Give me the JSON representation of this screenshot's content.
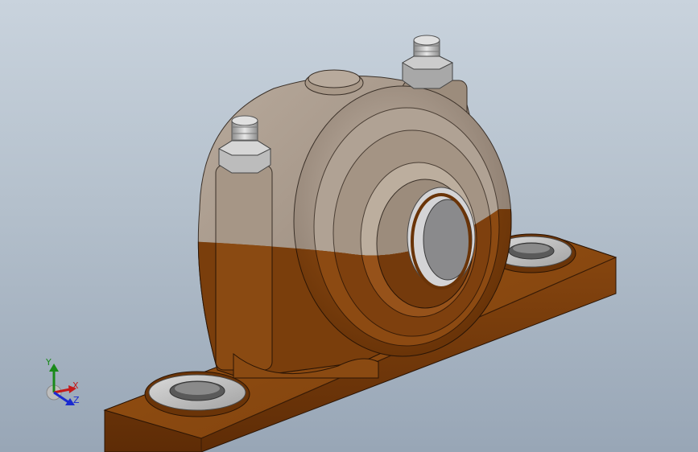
{
  "viewport": {
    "background_top": "#c9d3dd",
    "background_bottom": "#98a6b6"
  },
  "model": {
    "name": "pillow-block-bearing",
    "colors": {
      "upper_cap": "#a89888",
      "lower_base": "#8a4a12",
      "bearing_insert": "#d4d4d6",
      "bolt": "#c8c8c8"
    }
  },
  "triad": {
    "x_label": "X",
    "y_label": "Y",
    "z_label": "Z",
    "colors": {
      "x": "#c41a1a",
      "y": "#1a8a1a",
      "z": "#1a2ad0"
    }
  }
}
